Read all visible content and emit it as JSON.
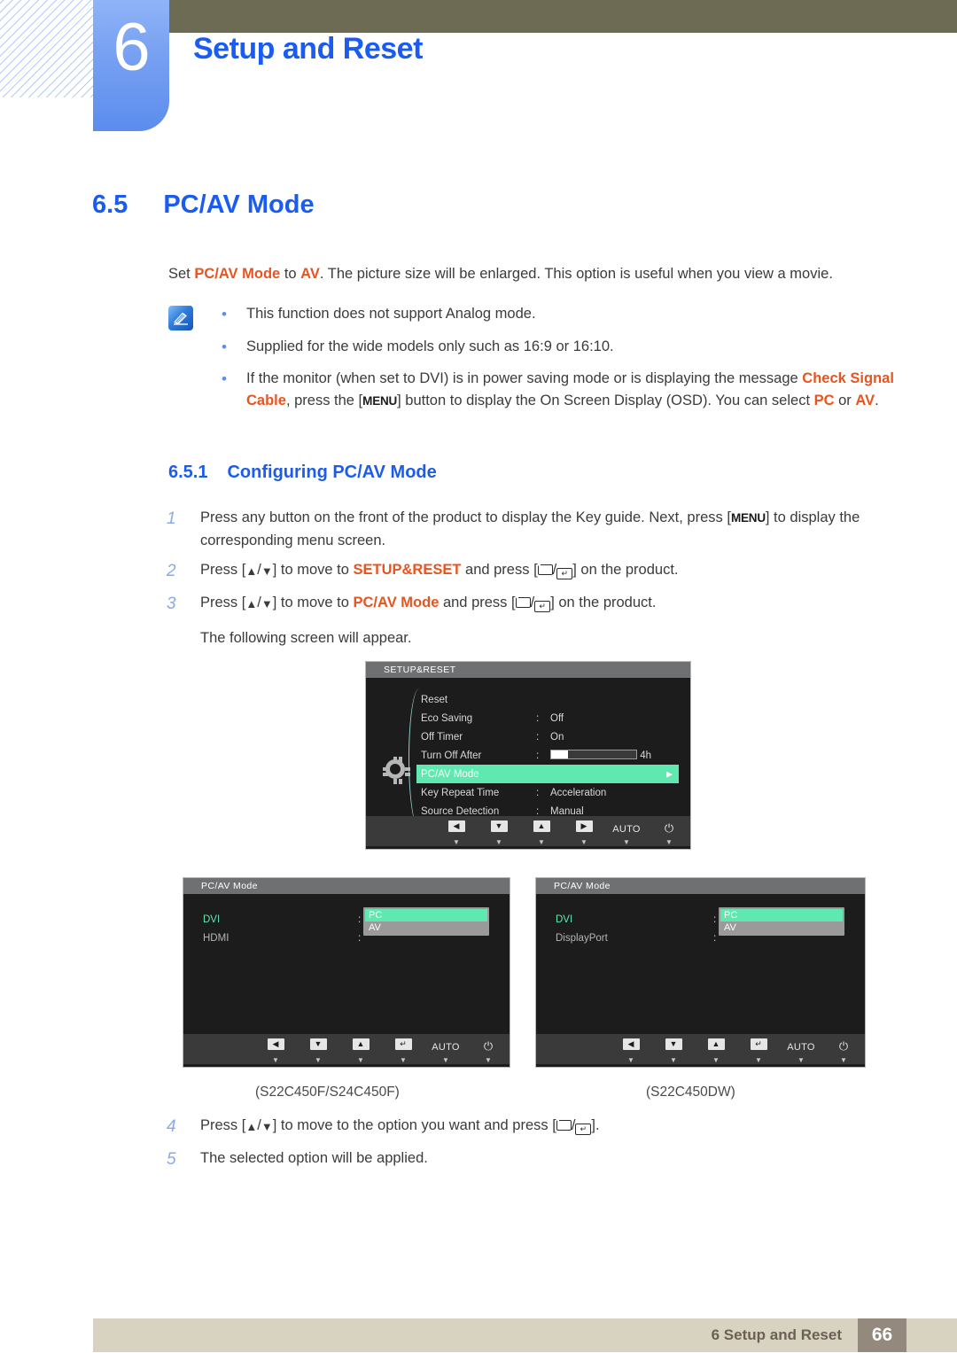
{
  "header": {
    "chapter_number": "6",
    "chapter_title": "Setup and Reset",
    "accent_blue": "#1b5cf0",
    "olive": "#6e6b55"
  },
  "section": {
    "number": "6.5",
    "title": "PC/AV Mode"
  },
  "intro": {
    "part1": "Set ",
    "em1": "PC/AV Mode",
    "part2": " to ",
    "em2": "AV",
    "part3": ". The picture size will be enlarged. This option is useful when you view a movie."
  },
  "note": {
    "icon": "note-pencil-icon",
    "bullets": [
      {
        "text": "This function does not support Analog mode."
      },
      {
        "text": "Supplied for the wide models only such as 16:9 or 16:10."
      },
      {
        "pre": "If the monitor (when set to DVI) is in power saving mode or is displaying the message ",
        "em1": "Check Signal Cable",
        "mid1": ", press the [",
        "key1": "MENU",
        "mid2": "] button to display the On Screen Display (OSD). You can select ",
        "em2": "PC",
        "mid3": " or ",
        "em3": "AV",
        "post": "."
      }
    ]
  },
  "subsection": {
    "number": "6.5.1",
    "title": "Configuring PC/AV Mode"
  },
  "steps_first": [
    {
      "num": "1",
      "pre": "Press any button on the front of the product to display the Key guide. Next, press [",
      "key": "MENU",
      "post": "] to display the corresponding menu screen."
    },
    {
      "num": "2",
      "pre": "Press [",
      "em": "SETUP&RESET",
      "mid": "] to move to ",
      "post": " and press [",
      "tail": "] on the product."
    },
    {
      "num": "3",
      "pre": "Press [",
      "em": "PC/AV Mode",
      "mid": "] to move to ",
      "post": " and press [",
      "tail": "] on the product."
    }
  ],
  "following_screen_text": "The following screen will appear.",
  "steps_last": [
    {
      "num": "4",
      "pre": "Press [",
      "mid": "] to move to the option you want and press [",
      "tail": "]."
    },
    {
      "num": "5",
      "text": "The selected option will be applied."
    }
  ],
  "osd_main": {
    "title": "SETUP&RESET",
    "highlight_color": "#5fe8b0",
    "rows": [
      {
        "label": "Reset",
        "colon": "",
        "value": ""
      },
      {
        "label": "Eco Saving",
        "colon": ":",
        "value": "Off"
      },
      {
        "label": "Off Timer",
        "colon": ":",
        "value": "On"
      },
      {
        "label": "Turn Off After",
        "colon": ":",
        "value": "4h",
        "slider": true,
        "slider_pct": 20
      },
      {
        "label": "PC/AV Mode",
        "colon": "",
        "value": "",
        "selected": true,
        "arrow": "▶"
      },
      {
        "label": "Key Repeat Time",
        "colon": ":",
        "value": "Acceleration"
      },
      {
        "label": "Source Detection",
        "colon": ":",
        "value": "Manual"
      }
    ],
    "more_indicator": "▼",
    "buttons": [
      {
        "name": "left-arrow-key",
        "glyph": "◀",
        "type": "box"
      },
      {
        "name": "down-arrow-key",
        "glyph": "▼",
        "type": "box"
      },
      {
        "name": "up-arrow-key",
        "glyph": "▲",
        "type": "box"
      },
      {
        "name": "right-arrow-key",
        "glyph": "▶",
        "type": "box"
      },
      {
        "name": "auto-key",
        "glyph": "AUTO",
        "type": "text"
      },
      {
        "name": "power-key",
        "glyph": "⏻",
        "type": "power"
      }
    ],
    "button_tri": "▼"
  },
  "osd_left": {
    "title": "PC/AV Mode",
    "rows": [
      {
        "label": "DVI",
        "active": true
      },
      {
        "label": "HDMI",
        "active": false
      }
    ],
    "dropdown": [
      {
        "label": "PC",
        "selected": true
      },
      {
        "label": "AV",
        "selected": false
      }
    ],
    "buttons": [
      {
        "name": "left-arrow-key",
        "glyph": "◀",
        "type": "box"
      },
      {
        "name": "down-arrow-key",
        "glyph": "▼",
        "type": "box"
      },
      {
        "name": "up-arrow-key",
        "glyph": "▲",
        "type": "box"
      },
      {
        "name": "enter-key",
        "glyph": "↵",
        "type": "box"
      },
      {
        "name": "auto-key",
        "glyph": "AUTO",
        "type": "text"
      },
      {
        "name": "power-key",
        "glyph": "⏻",
        "type": "power"
      }
    ],
    "button_tri": "▼",
    "caption": "(S22C450F/S24C450F)"
  },
  "osd_right": {
    "title": "PC/AV Mode",
    "rows": [
      {
        "label": "DVI",
        "active": true
      },
      {
        "label": "DisplayPort",
        "active": false
      }
    ],
    "dropdown": [
      {
        "label": "PC",
        "selected": true
      },
      {
        "label": "AV",
        "selected": false
      }
    ],
    "buttons": [
      {
        "name": "left-arrow-key",
        "glyph": "◀",
        "type": "box"
      },
      {
        "name": "down-arrow-key",
        "glyph": "▼",
        "type": "box"
      },
      {
        "name": "up-arrow-key",
        "glyph": "▲",
        "type": "box"
      },
      {
        "name": "enter-key",
        "glyph": "↵",
        "type": "box"
      },
      {
        "name": "auto-key",
        "glyph": "AUTO",
        "type": "text"
      },
      {
        "name": "power-key",
        "glyph": "⏻",
        "type": "power"
      }
    ],
    "button_tri": "▼",
    "caption": "(S22C450DW)"
  },
  "footer": {
    "text": "6 Setup and Reset",
    "page": "66",
    "bar_color": "#d8d3c0",
    "page_box_color": "#93897c"
  }
}
